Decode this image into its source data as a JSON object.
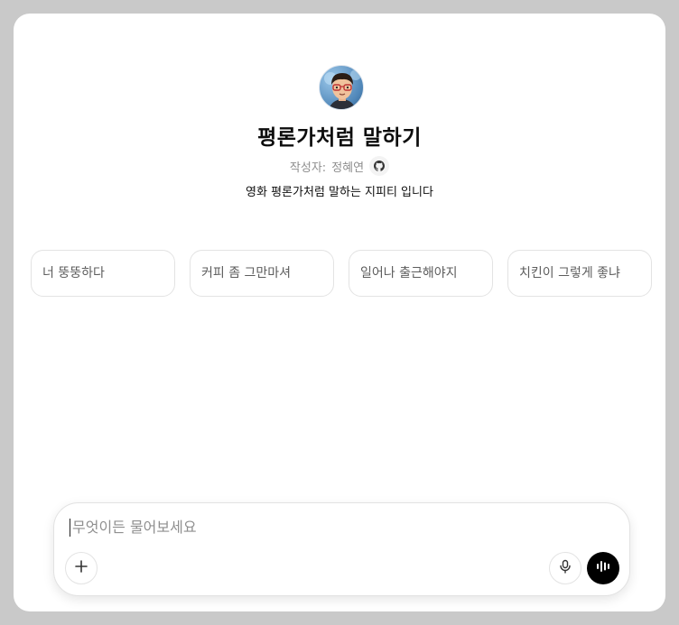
{
  "gpt": {
    "title": "평론가처럼 말하기",
    "author_prefix": "작성자:",
    "author_name": "정혜연",
    "description": "영화 평론가처럼 말하는 지피티 입니다"
  },
  "starters": [
    "너 뚱뚱하다",
    "커피 좀 그만마셔",
    "일어나 출근해야지",
    "치킨이 그렇게 좋냐"
  ],
  "composer": {
    "placeholder": "무엇이든 물어보세요"
  },
  "icons": {
    "github": "github-icon",
    "plus": "plus-icon",
    "mic": "microphone-icon",
    "voice": "voice-mode-icon"
  }
}
